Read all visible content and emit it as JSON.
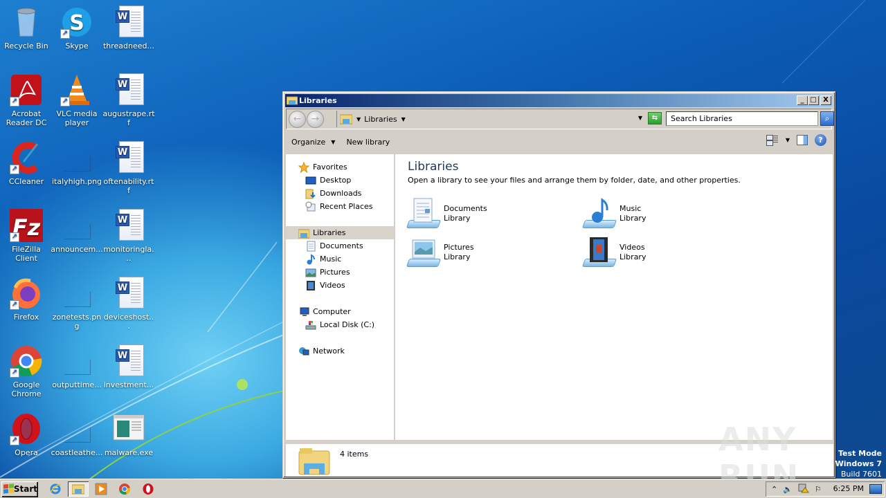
{
  "desktop": {
    "icons": [
      {
        "label": "Recycle Bin",
        "icon": "recycle-bin-icon",
        "shortcut": false
      },
      {
        "label": "Skype",
        "icon": "skype-icon",
        "shortcut": true
      },
      {
        "label": "threadneed...",
        "icon": "word-document-icon",
        "shortcut": false
      },
      {
        "label": "Acrobat Reader DC",
        "icon": "acrobat-icon",
        "shortcut": true
      },
      {
        "label": "VLC media player",
        "icon": "vlc-icon",
        "shortcut": true
      },
      {
        "label": "augustrape.rtf",
        "icon": "word-document-icon",
        "shortcut": false
      },
      {
        "label": "CCleaner",
        "icon": "ccleaner-icon",
        "shortcut": true
      },
      {
        "label": "italyhigh.png",
        "icon": "image-file-icon",
        "shortcut": false
      },
      {
        "label": "oftenability.rtf",
        "icon": "word-document-icon",
        "shortcut": false
      },
      {
        "label": "FileZilla Client",
        "icon": "filezilla-icon",
        "shortcut": true
      },
      {
        "label": "announcem...",
        "icon": "image-file-icon",
        "shortcut": false
      },
      {
        "label": "monitoringla...",
        "icon": "word-document-icon",
        "shortcut": false
      },
      {
        "label": "Firefox",
        "icon": "firefox-icon",
        "shortcut": true
      },
      {
        "label": "zonetests.png",
        "icon": "image-file-icon",
        "shortcut": false
      },
      {
        "label": "deviceshost...",
        "icon": "word-document-icon",
        "shortcut": false
      },
      {
        "label": "Google Chrome",
        "icon": "chrome-icon",
        "shortcut": true
      },
      {
        "label": "outputtime...",
        "icon": "image-file-icon",
        "shortcut": false
      },
      {
        "label": "investment...",
        "icon": "word-document-icon",
        "shortcut": false
      },
      {
        "label": "Opera",
        "icon": "opera-icon",
        "shortcut": true
      },
      {
        "label": "coastleathe...",
        "icon": "image-file-icon",
        "shortcut": false
      },
      {
        "label": "malware.exe",
        "icon": "executable-icon",
        "shortcut": false
      }
    ]
  },
  "window": {
    "title": "Libraries",
    "controls": {
      "minimize": "_",
      "maximize": "□",
      "close": "X"
    },
    "address": {
      "breadcrumb": "Libraries"
    },
    "search": {
      "placeholder": "Search Libraries"
    },
    "toolbar": {
      "organize": "Organize",
      "new_library": "New library"
    },
    "nav": {
      "favorites": "Favorites",
      "desktop": "Desktop",
      "downloads": "Downloads",
      "recent_places": "Recent Places",
      "libraries": "Libraries",
      "documents": "Documents",
      "music": "Music",
      "pictures": "Pictures",
      "videos": "Videos",
      "computer": "Computer",
      "local_disk": "Local Disk (C:)",
      "network": "Network"
    },
    "content": {
      "heading": "Libraries",
      "description": "Open a library to see your files and arrange them by folder, date, and other properties.",
      "libraries": [
        {
          "name": "Documents",
          "type": "Library"
        },
        {
          "name": "Music",
          "type": "Library"
        },
        {
          "name": "Pictures",
          "type": "Library"
        },
        {
          "name": "Videos",
          "type": "Library"
        }
      ]
    },
    "status": {
      "item_count": "4 items"
    }
  },
  "overlay": {
    "watermark": "ANY RUN",
    "test_mode": "Test Mode",
    "os": "Windows 7",
    "build": "Build 7601"
  },
  "taskbar": {
    "start_label": "Start",
    "apps": [
      "internet-explorer",
      "windows-explorer",
      "media-player",
      "chrome",
      "opera"
    ],
    "clock": "6:25 PM"
  }
}
